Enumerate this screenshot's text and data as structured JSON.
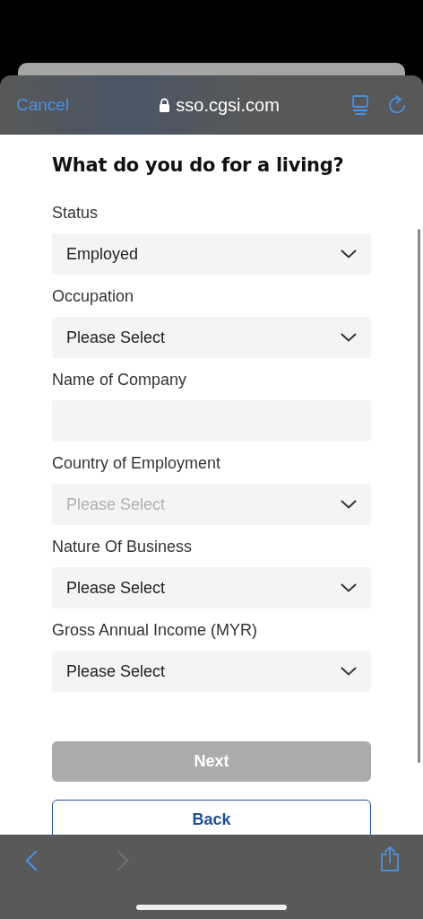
{
  "browser": {
    "cancel": "Cancel",
    "url": "sso.cgsi.com",
    "back_disabled": false,
    "forward_disabled": true
  },
  "form": {
    "title": "What do you do for a living?",
    "fields": [
      {
        "label": "Status",
        "kind": "select",
        "value": "Employed",
        "disabled": false
      },
      {
        "label": "Occupation",
        "kind": "select",
        "value": "Please Select",
        "disabled": false
      },
      {
        "label": "Name of Company",
        "kind": "text"
      },
      {
        "label": "Country of Employment",
        "kind": "select",
        "placeholder": "Please Select",
        "disabled": true
      },
      {
        "label": "Nature Of Business",
        "kind": "select",
        "value": "Please Select",
        "disabled": false
      },
      {
        "label": "Gross Annual Income (MYR)",
        "kind": "select",
        "value": "Please Select",
        "disabled": false
      }
    ]
  },
  "buttons": [
    {
      "label": "Next",
      "kind": "primary",
      "disabled": true
    },
    {
      "label": "Back",
      "kind": "outline",
      "disabled": false
    }
  ]
}
